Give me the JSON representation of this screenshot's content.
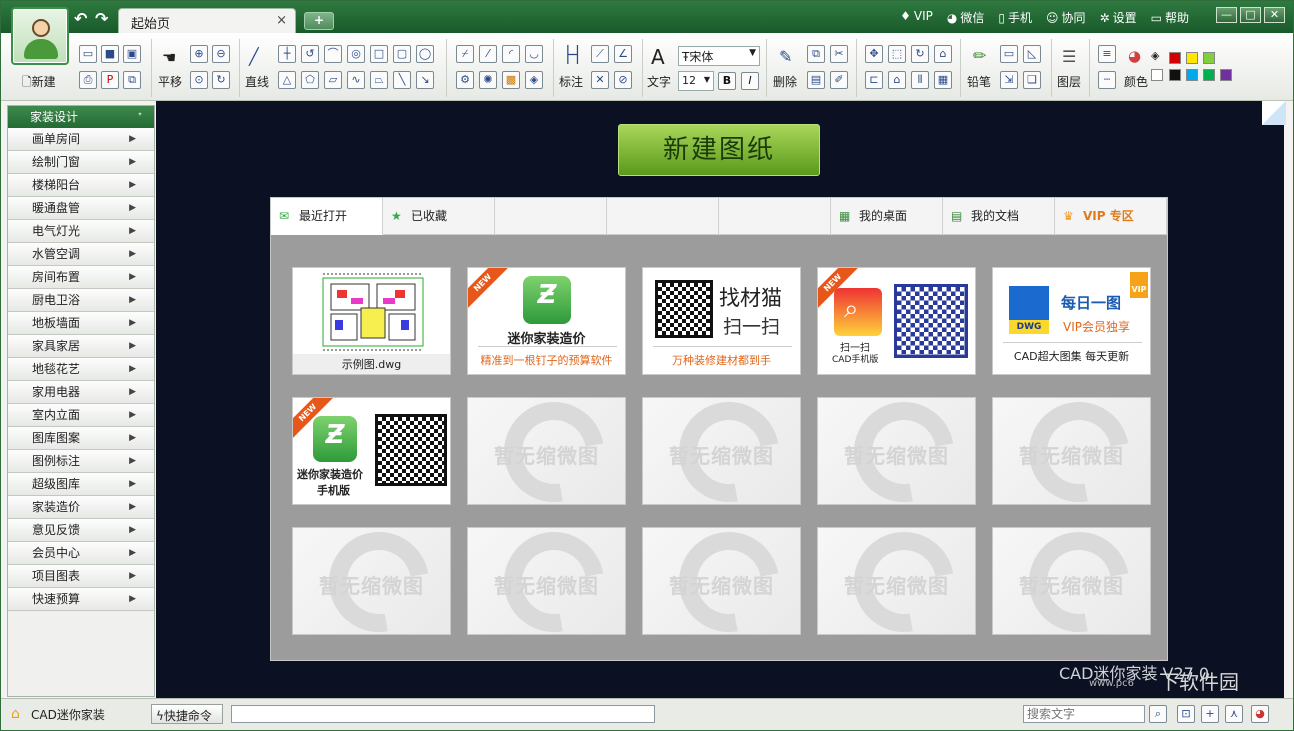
{
  "title_bar": {
    "tab_label": "起始页",
    "tab_close": "×",
    "add_tab": "+",
    "menu": [
      {
        "icon": "vip-diamond-icon",
        "label": "VIP"
      },
      {
        "icon": "wechat-icon",
        "label": "微信"
      },
      {
        "icon": "phone-icon",
        "label": "手机"
      },
      {
        "icon": "people-icon",
        "label": "协同"
      },
      {
        "icon": "gear-icon",
        "label": "设置"
      },
      {
        "icon": "chat-icon",
        "label": "帮助"
      }
    ],
    "window_buttons": [
      "—",
      "□",
      "✕"
    ]
  },
  "toolbar": {
    "new_label": "新建",
    "pan_label": "平移",
    "line_label": "直线",
    "dimension_label": "标注",
    "text_label": "文字",
    "font_name": "宋体",
    "font_size": "12",
    "bold": "B",
    "italic": "I",
    "delete_label": "删除",
    "pencil_label": "铅笔",
    "layer_label": "图层",
    "color_label": "颜色",
    "colors_row1": [
      "#d40000",
      "#ffe600",
      "#7fd03c"
    ],
    "colors_row2": [
      "#111111",
      "#00a8ec",
      "#00b050",
      "#7030a0"
    ]
  },
  "sidebar": {
    "header": "家装设计",
    "pin": "ᐩ",
    "items": [
      "画单房间",
      "绘制门窗",
      "楼梯阳台",
      "暖通盘管",
      "电气灯光",
      "水管空调",
      "房间布置",
      "厨电卫浴",
      "地板墙面",
      "家具家居",
      "地毯花艺",
      "家用电器",
      "室内立面",
      "图库图案",
      "图例标注",
      "超级图库",
      "家装造价",
      "意见反馈",
      "会员中心",
      "项目图表",
      "快速预算"
    ]
  },
  "canvas": {
    "new_drawing_button": "新建图纸",
    "tabs": [
      {
        "label": "最近打开",
        "icon": "mail-icon"
      },
      {
        "label": "已收藏",
        "icon": "star-icon"
      },
      {
        "label": "",
        "icon": ""
      },
      {
        "label": "",
        "icon": ""
      },
      {
        "label": "",
        "icon": ""
      },
      {
        "label": "我的桌面",
        "icon": "desktop-icon"
      },
      {
        "label": "我的文档",
        "icon": "document-icon"
      },
      {
        "label": "VIP 专区",
        "icon": "vip-crown-icon"
      }
    ],
    "tiles": {
      "sample": {
        "caption": "示例图.dwg"
      },
      "estimate": {
        "ribbon": "NEW",
        "title": "迷你家装造价",
        "subtitle": "精准到一根钉子的预算软件"
      },
      "zhaocaimao": {
        "title": "找材猫",
        "scan": "扫一扫",
        "subtitle": "万种装修建材都到手"
      },
      "cad_mobile": {
        "ribbon": "NEW",
        "scan": "扫一扫",
        "subtitle": "CAD手机版"
      },
      "daily": {
        "title": "每日一图",
        "badge": "VIP",
        "dwg": "DWG",
        "vip_line": "VIP会员独享",
        "subtitle": "CAD超大图集 每天更新"
      },
      "estimate_mobile": {
        "ribbon": "NEW",
        "title": "迷你家装造价",
        "subtitle": "手机版"
      },
      "empty_label": "暂无缩微图"
    },
    "watermark": {
      "product": "CAD迷你家装 V27.0",
      "url": "www.pc6",
      "site": "下软件园"
    }
  },
  "statusbar": {
    "app_name": "CAD迷你家装",
    "shortcut_label": "快捷命令",
    "search_placeholder": "搜索文字"
  }
}
